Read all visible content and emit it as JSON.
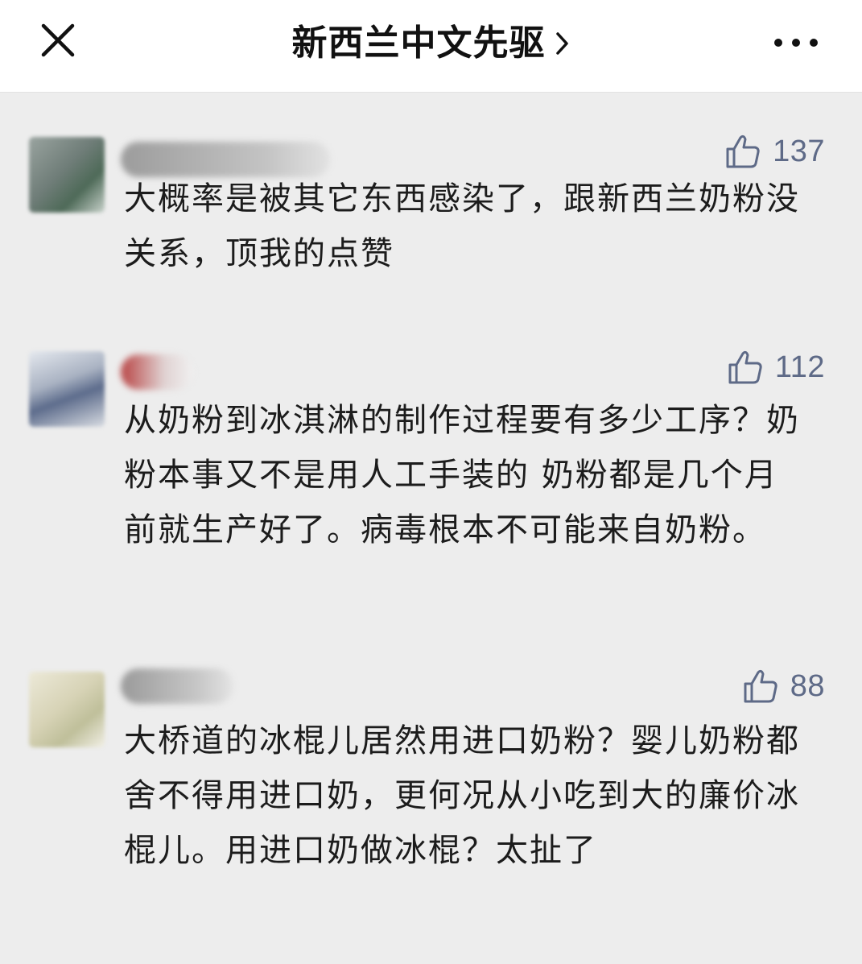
{
  "header": {
    "title": "新西兰中文先驱",
    "close_icon": "close-icon",
    "chevron_icon": "chevron-right-icon",
    "more_icon": "more-dots-icon"
  },
  "comments": [
    {
      "likes": "137",
      "text": "大概率是被其它东西感染了，跟新西兰奶粉没关系，顶我的点赞"
    },
    {
      "likes": "112",
      "text": "从奶粉到冰淇淋的制作过程要有多少工序？奶粉本事又不是用人工手装的 奶粉都是几个月前就生产好了。病毒根本不可能来自奶粉。"
    },
    {
      "likes": "88",
      "text": "大桥道的冰棍儿居然用进口奶粉？婴儿奶粉都舍不得用进口奶，更何况从小吃到大的廉价冰棍儿。用进口奶做冰棍？太扯了"
    }
  ],
  "colors": {
    "background": "#ededed",
    "header_bg": "#ffffff",
    "like_color": "#5e6a87",
    "text": "#1c1c1c"
  },
  "icons": {
    "like": "thumbs-up-icon"
  }
}
